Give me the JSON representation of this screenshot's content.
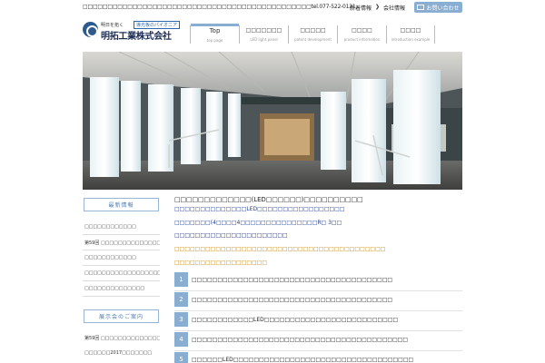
{
  "header": {
    "tagline": "□□□□□□□□□□□□□□□□□□□□□□□□□□□□□□□□□□□□□□□□□□□□□□tel.077-522-0121",
    "toplinks": [
      "新着情報",
      "会社情報"
    ],
    "contact_label": "お問い合わせ",
    "logo": {
      "slogan": "明日を拓く",
      "pioneer": "導光板のパイオニア",
      "name": "明拓工業株式会社"
    }
  },
  "nav": [
    {
      "jp": "Top",
      "en": "top page"
    },
    {
      "jp": "□□□□□□□",
      "en": "LED light panel"
    },
    {
      "jp": "□□□□□",
      "en": "patent development"
    },
    {
      "jp": "□□□□",
      "en": "product information"
    },
    {
      "jp": "□□□□",
      "en": "introduction example"
    }
  ],
  "sidebar": {
    "news_header": "最新情報",
    "news_items": [
      "□□□□□□□□□□□□",
      "第59回 □□□□□□□□□□□□□□□□□□□□□",
      "□□□□□□□□□□□□",
      "□□□□□□□□□□□□□□□□□□□□□□□",
      "□□□□□□□□□□□□□□"
    ],
    "exhibit_header": "展示会のご案内",
    "exhibit_items": [
      "第59回 □□□□□□□□□□□□□□□□□□□□□",
      "□□□□□□2017□□□□□□□"
    ]
  },
  "main": {
    "title": "□□□□□□□□□□□□□(LED□□□□□□)□□□□□□□□□□",
    "lines": [
      "□□□□□□□□□□□□□□LED□□□□□□□□□□□□□□□□□",
      "□□□□□□□(4□□□□4□□□□□□□□□□□□□□□R□ 3□□",
      "□□□□□□□□□□□□□□□□□□□□□□",
      "□□□□□□□□□□□□□□□□□□□□□□□□□□□□□□□□□□□□□□□□□",
      "□□□□□□□□□□□□□□□□□□"
    ],
    "steps": [
      {
        "num": "1",
        "text": "□□□□□□□□□□□□□□□□□□□□□□□□□□□□□□□□□□□□□□□"
      },
      {
        "num": "2",
        "text": "□□□□□□□□□□□□□□□□□□□□□□□□□□□□□□□□□□□□□□□"
      },
      {
        "num": "3",
        "text": "□□□□□□□□□□□□LED□□□□□□□□□□□□□□□□□□□□□□□□□□"
      },
      {
        "num": "4",
        "text": "□□□□□□□□□□□□□□□□□□□□□□□□□□□□□□□□□□□□□□□□□□"
      },
      {
        "num": "5",
        "text": "□□□□□□LED□□□□□□□□□□□□□□□□□□□□□□□□□□□□□□□□□□□"
      }
    ]
  },
  "colors": {
    "accent": "#8aaed1",
    "link_blue": "#1d3b8a",
    "highlight_orange": "#c78a0b",
    "logo_navy": "#1e2d54"
  }
}
